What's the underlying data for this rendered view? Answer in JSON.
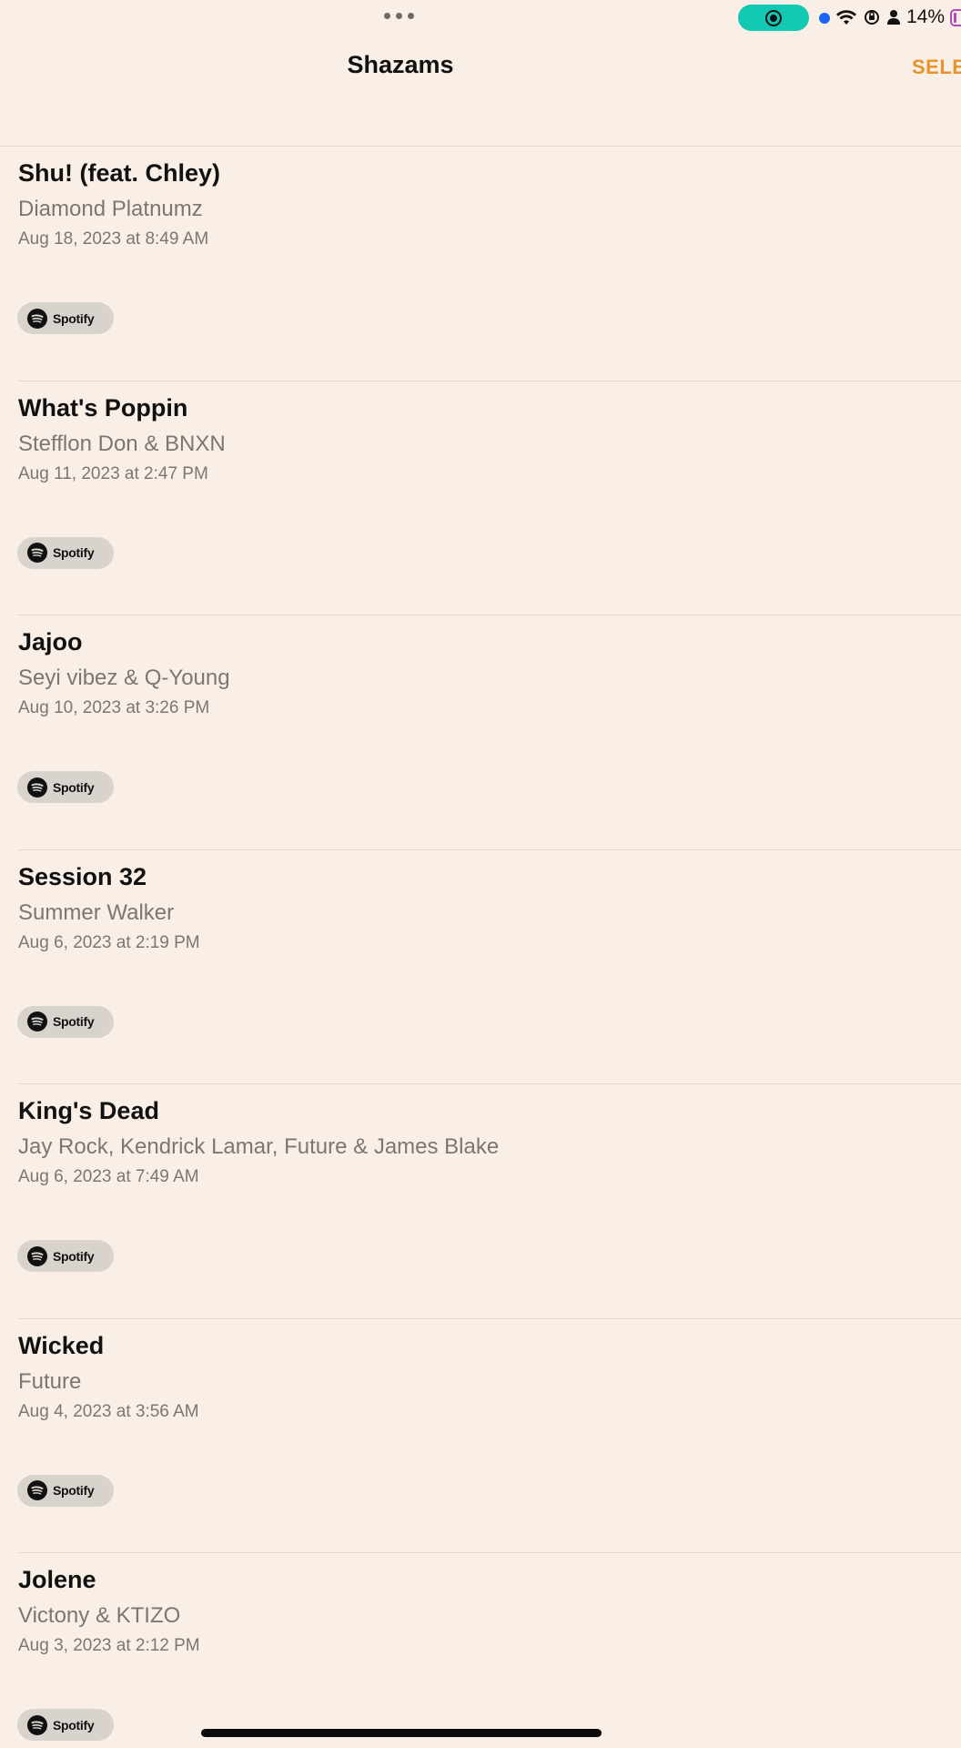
{
  "status_bar": {
    "battery_percent": "14%"
  },
  "header": {
    "title": "Shazams",
    "select_label": "SELE"
  },
  "spotify_label": "Spotify",
  "items": [
    {
      "title": "Shu! (feat. Chley)",
      "artist": "Diamond Platnumz",
      "date": "Aug 18, 2023 at 8:49 AM"
    },
    {
      "title": "What's Poppin",
      "artist": "Stefflon Don & BNXN",
      "date": "Aug 11, 2023 at 2:47 PM"
    },
    {
      "title": "Jajoo",
      "artist": "Seyi vibez & Q-Young",
      "date": "Aug 10, 2023 at 3:26 PM"
    },
    {
      "title": "Session 32",
      "artist": "Summer Walker",
      "date": "Aug 6, 2023 at 2:19 PM"
    },
    {
      "title": "King's Dead",
      "artist": "Jay Rock, Kendrick Lamar, Future & James Blake",
      "date": "Aug 6, 2023 at 7:49 AM"
    },
    {
      "title": "Wicked",
      "artist": "Future",
      "date": "Aug 4, 2023 at 3:56 AM"
    },
    {
      "title": "Jolene",
      "artist": "Victony & KTIZO",
      "date": "Aug 3, 2023 at 2:12 PM"
    }
  ]
}
